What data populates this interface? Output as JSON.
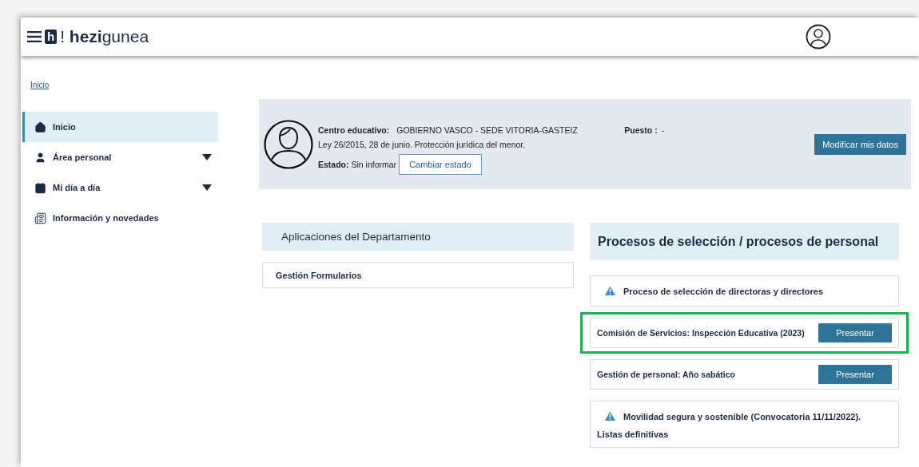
{
  "header": {
    "logo_mark": "h",
    "logo_text": "! **hezi**gunea"
  },
  "breadcrumb": "Inicio",
  "sidebar": {
    "items": [
      {
        "label": "Inicio",
        "kind": "home",
        "selected": true,
        "expandable": false
      },
      {
        "label": "Área personal",
        "kind": "person",
        "selected": false,
        "expandable": true
      },
      {
        "label": "Mi día a día",
        "kind": "calendar",
        "selected": false,
        "expandable": true
      },
      {
        "label": "Información y novedades",
        "kind": "news",
        "selected": false,
        "expandable": false
      }
    ]
  },
  "profile": {
    "centro_label": "Centro educativo:",
    "centro_value": "GOBIERNO VASCO - SEDE VITORIA-GASTEIZ",
    "puesto_label": "Puesto :",
    "puesto_value": "-",
    "law": "Ley 26/2015, 28 de junio. Protección jurídica del menor.",
    "estado_label": "Estado:",
    "estado_value": "Sin informar",
    "change_button": "Cambiar estado",
    "edit_button": "Modificar mis datos"
  },
  "applications": {
    "title": "Aplicaciones del Departamento",
    "items": [
      "Gestión Formularios"
    ]
  },
  "processes": {
    "title": "Procesos de selección / procesos de personal",
    "items": [
      {
        "kind": "notice",
        "text": "Proceso de selección de directoras y directores",
        "highlighted": false
      },
      {
        "kind": "action",
        "text": "Comisión de Servicios: Inspección Educativa (2023)",
        "button": "Presentar",
        "highlighted": true
      },
      {
        "kind": "action",
        "text": "Gestión de personal: Año sabático",
        "button": "Presentar",
        "highlighted": false
      },
      {
        "kind": "notice",
        "text": "Movilidad segura y sostenible (Convocatoria 11/11/2022).",
        "subtext": "Listas definitivas",
        "highlighted": false
      }
    ]
  }
}
